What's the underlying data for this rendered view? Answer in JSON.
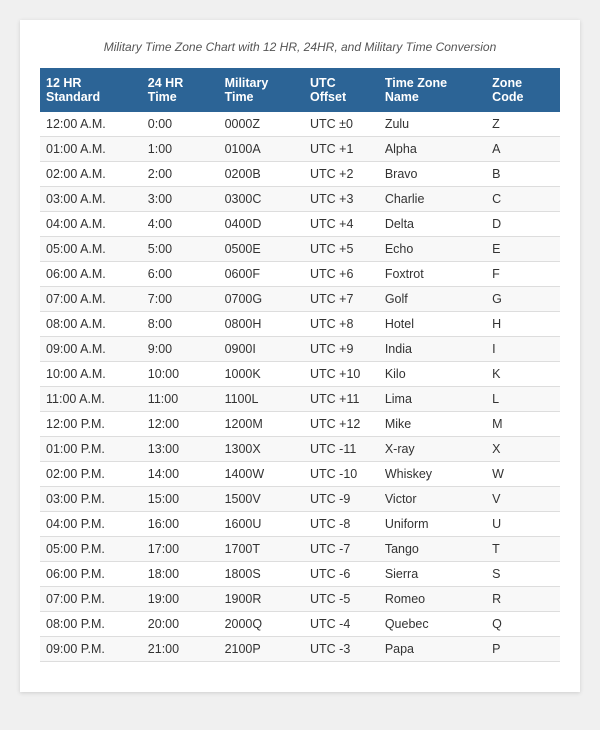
{
  "subtitle": "Military Time Zone Chart with 12 HR, 24HR, and Military Time Conversion",
  "columns": [
    "12 HR Standard",
    "24 HR Time",
    "Military Time",
    "UTC Offset",
    "Time Zone Name",
    "Zone Code"
  ],
  "rows": [
    [
      "12:00 A.M.",
      "0:00",
      "0000Z",
      "UTC ±0",
      "Zulu",
      "Z"
    ],
    [
      "01:00 A.M.",
      "1:00",
      "0100A",
      "UTC +1",
      "Alpha",
      "A"
    ],
    [
      "02:00 A.M.",
      "2:00",
      "0200B",
      "UTC +2",
      "Bravo",
      "B"
    ],
    [
      "03:00 A.M.",
      "3:00",
      "0300C",
      "UTC +3",
      "Charlie",
      "C"
    ],
    [
      "04:00 A.M.",
      "4:00",
      "0400D",
      "UTC +4",
      "Delta",
      "D"
    ],
    [
      "05:00 A.M.",
      "5:00",
      "0500E",
      "UTC +5",
      "Echo",
      "E"
    ],
    [
      "06:00 A.M.",
      "6:00",
      "0600F",
      "UTC +6",
      "Foxtrot",
      "F"
    ],
    [
      "07:00 A.M.",
      "7:00",
      "0700G",
      "UTC +7",
      "Golf",
      "G"
    ],
    [
      "08:00 A.M.",
      "8:00",
      "0800H",
      "UTC +8",
      "Hotel",
      "H"
    ],
    [
      "09:00 A.M.",
      "9:00",
      "0900I",
      "UTC +9",
      "India",
      "I"
    ],
    [
      "10:00 A.M.",
      "10:00",
      "1000K",
      "UTC +10",
      "Kilo",
      "K"
    ],
    [
      "11:00 A.M.",
      "11:00",
      "1100L",
      "UTC +11",
      "Lima",
      "L"
    ],
    [
      "12:00 P.M.",
      "12:00",
      "1200M",
      "UTC +12",
      "Mike",
      "M"
    ],
    [
      "01:00 P.M.",
      "13:00",
      "1300X",
      "UTC -11",
      "X-ray",
      "X"
    ],
    [
      "02:00 P.M.",
      "14:00",
      "1400W",
      "UTC -10",
      "Whiskey",
      "W"
    ],
    [
      "03:00 P.M.",
      "15:00",
      "1500V",
      "UTC -9",
      "Victor",
      "V"
    ],
    [
      "04:00 P.M.",
      "16:00",
      "1600U",
      "UTC -8",
      "Uniform",
      "U"
    ],
    [
      "05:00 P.M.",
      "17:00",
      "1700T",
      "UTC -7",
      "Tango",
      "T"
    ],
    [
      "06:00 P.M.",
      "18:00",
      "1800S",
      "UTC -6",
      "Sierra",
      "S"
    ],
    [
      "07:00 P.M.",
      "19:00",
      "1900R",
      "UTC -5",
      "Romeo",
      "R"
    ],
    [
      "08:00 P.M.",
      "20:00",
      "2000Q",
      "UTC -4",
      "Quebec",
      "Q"
    ],
    [
      "09:00 P.M.",
      "21:00",
      "2100P",
      "UTC -3",
      "Papa",
      "P"
    ]
  ]
}
